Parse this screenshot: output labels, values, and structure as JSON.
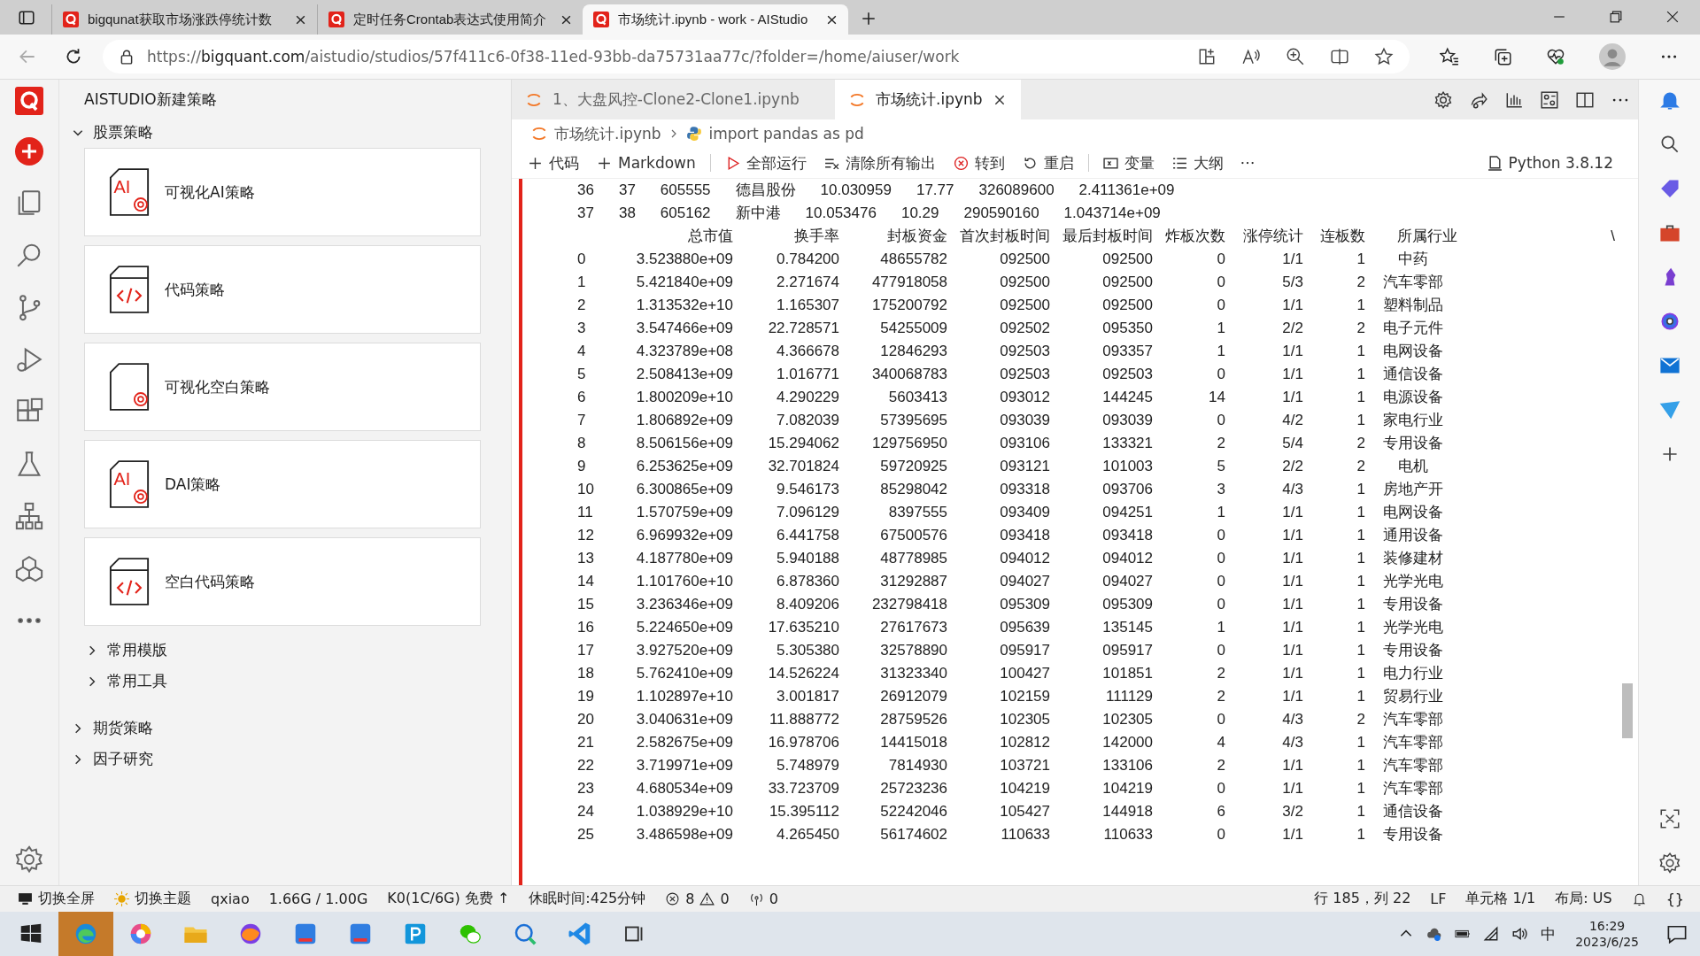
{
  "browser": {
    "tabs": [
      {
        "title": "bigqunat获取市场涨跌停统计数",
        "selected": false
      },
      {
        "title": "定时任务Crontab表达式使用简介",
        "selected": false
      },
      {
        "title": "市场统计.ipynb - work - AIStudio",
        "selected": true
      }
    ],
    "url": {
      "scheme": "https://",
      "host": "bigquant.com",
      "path": "/aistudio/studios/57f411c6-0f38-11ed-93bb-da75731aa77c/?folder=/home/aiuser/work"
    }
  },
  "sidebar": {
    "title": "AISTUDIO新建策略",
    "tree": [
      {
        "label": "股票策略",
        "expanded": true,
        "cards": [
          {
            "label": "可视化AI策略",
            "kind": "ai",
            "icon_text": "AI"
          },
          {
            "label": "代码策略",
            "kind": "code"
          },
          {
            "label": "可视化空白策略",
            "kind": "blank"
          },
          {
            "label": "DAI策略",
            "kind": "ai",
            "icon_text": "AI"
          },
          {
            "label": "空白代码策略",
            "kind": "code"
          }
        ],
        "children": [
          {
            "label": "常用模版",
            "expanded": false
          },
          {
            "label": "常用工具",
            "expanded": false
          }
        ]
      },
      {
        "label": "期货策略",
        "expanded": false
      },
      {
        "label": "因子研究",
        "expanded": false
      }
    ]
  },
  "editor": {
    "tabs": [
      {
        "title": "1、大盘风控-Clone2-Clone1.ipynb",
        "selected": false
      },
      {
        "title": "市场统计.ipynb",
        "selected": true
      }
    ],
    "breadcrumb": [
      "市场统计.ipynb",
      "import pandas as pd"
    ],
    "toolbar": [
      "代码",
      "Markdown",
      "全部运行",
      "清除所有输出",
      "转到",
      "重启",
      "变量",
      "大纲"
    ],
    "kernel": "Python 3.8.12",
    "output": {
      "top_rows": [
        [
          "36",
          "37",
          "605555",
          "德昌股份",
          "10.030959",
          "17.77",
          "326089600",
          "2.411361e+09"
        ],
        [
          "37",
          "38",
          "605162",
          "新中港",
          "10.053476",
          "10.29",
          "290590160",
          "1.043714e+09"
        ]
      ],
      "columns": [
        "",
        "总市值",
        "换手率",
        "封板资金",
        "首次封板时间",
        "最后封板时间",
        "炸板次数",
        "涨停统计",
        "连板数",
        "所属行业"
      ],
      "continuation": "\\",
      "rows": [
        [
          "0",
          "3.523880e+09",
          "0.784200",
          "48655782",
          "092500",
          "092500",
          "0",
          "1/1",
          "1",
          "中药"
        ],
        [
          "1",
          "5.421840e+09",
          "2.271674",
          "477918058",
          "092500",
          "092500",
          "0",
          "5/3",
          "2",
          "汽车零部"
        ],
        [
          "2",
          "1.313532e+10",
          "1.165307",
          "175200792",
          "092500",
          "092500",
          "0",
          "1/1",
          "1",
          "塑料制品"
        ],
        [
          "3",
          "3.547466e+09",
          "22.728571",
          "54255009",
          "092502",
          "095350",
          "1",
          "2/2",
          "2",
          "电子元件"
        ],
        [
          "4",
          "4.323789e+08",
          "4.366678",
          "12846293",
          "092503",
          "093357",
          "1",
          "1/1",
          "1",
          "电网设备"
        ],
        [
          "5",
          "2.508413e+09",
          "1.016771",
          "340068783",
          "092503",
          "092503",
          "0",
          "1/1",
          "1",
          "通信设备"
        ],
        [
          "6",
          "1.800209e+10",
          "4.290229",
          "5603413",
          "093012",
          "144245",
          "14",
          "1/1",
          "1",
          "电源设备"
        ],
        [
          "7",
          "1.806892e+09",
          "7.082039",
          "57395695",
          "093039",
          "093039",
          "0",
          "4/2",
          "1",
          "家电行业"
        ],
        [
          "8",
          "8.506156e+09",
          "15.294062",
          "129756950",
          "093106",
          "133321",
          "2",
          "5/4",
          "2",
          "专用设备"
        ],
        [
          "9",
          "6.253625e+09",
          "32.701824",
          "59720925",
          "093121",
          "101003",
          "5",
          "2/2",
          "2",
          "电机"
        ],
        [
          "10",
          "6.300865e+09",
          "9.546173",
          "85298042",
          "093318",
          "093706",
          "3",
          "4/3",
          "1",
          "房地产开"
        ],
        [
          "11",
          "1.570759e+09",
          "7.096129",
          "8397555",
          "093409",
          "094251",
          "1",
          "1/1",
          "1",
          "电网设备"
        ],
        [
          "12",
          "6.969932e+09",
          "6.441758",
          "67500576",
          "093418",
          "093418",
          "0",
          "1/1",
          "1",
          "通用设备"
        ],
        [
          "13",
          "4.187780e+09",
          "5.940188",
          "48778985",
          "094012",
          "094012",
          "0",
          "1/1",
          "1",
          "装修建材"
        ],
        [
          "14",
          "1.101760e+10",
          "6.878360",
          "31292887",
          "094027",
          "094027",
          "0",
          "1/1",
          "1",
          "光学光电"
        ],
        [
          "15",
          "3.236346e+09",
          "8.409206",
          "232798418",
          "095309",
          "095309",
          "0",
          "1/1",
          "1",
          "专用设备"
        ],
        [
          "16",
          "5.224650e+09",
          "17.635210",
          "27617673",
          "095639",
          "135145",
          "1",
          "1/1",
          "1",
          "光学光电"
        ],
        [
          "17",
          "3.927520e+09",
          "5.305380",
          "32578890",
          "095917",
          "095917",
          "0",
          "1/1",
          "1",
          "专用设备"
        ],
        [
          "18",
          "5.762410e+09",
          "14.526224",
          "31323340",
          "100427",
          "101851",
          "2",
          "1/1",
          "1",
          "电力行业"
        ],
        [
          "19",
          "1.102897e+10",
          "3.001817",
          "26912079",
          "102159",
          "111129",
          "2",
          "1/1",
          "1",
          "贸易行业"
        ],
        [
          "20",
          "3.040631e+09",
          "11.888772",
          "28759526",
          "102305",
          "102305",
          "0",
          "4/3",
          "2",
          "汽车零部"
        ],
        [
          "21",
          "2.582675e+09",
          "16.978706",
          "14415018",
          "102812",
          "142000",
          "4",
          "4/3",
          "1",
          "汽车零部"
        ],
        [
          "22",
          "3.719971e+09",
          "5.748979",
          "7814930",
          "103721",
          "133106",
          "2",
          "1/1",
          "1",
          "汽车零部"
        ],
        [
          "23",
          "4.680534e+09",
          "33.723709",
          "25723236",
          "104219",
          "104219",
          "0",
          "1/1",
          "1",
          "汽车零部"
        ],
        [
          "24",
          "1.038929e+10",
          "15.395112",
          "52242046",
          "105427",
          "144918",
          "6",
          "3/2",
          "1",
          "通信设备"
        ],
        [
          "25",
          "3.486598e+09",
          "4.265450",
          "56174602",
          "110633",
          "110633",
          "0",
          "1/1",
          "1",
          "专用设备"
        ]
      ]
    }
  },
  "status_bar": {
    "left": [
      "切换全屏",
      "切换主题",
      "qxiao",
      "1.66G / 1.00G",
      "K0(1C/6G) 免费 ↑",
      "休眠时间:425分钟"
    ],
    "errors": "8",
    "warnings": "0",
    "ports": "0",
    "right": [
      "行 185，列 22",
      "LF",
      "单元格 1/1",
      "布局: US"
    ],
    "braces": "{}"
  },
  "taskbar": {
    "apps": [
      {
        "selected": false
      },
      {
        "selected": true
      },
      {
        "selected": false
      },
      {
        "selected": false
      },
      {
        "selected": false
      },
      {
        "selected": false
      },
      {
        "selected": false
      },
      {
        "selected": false
      },
      {
        "selected": false
      },
      {
        "selected": false
      },
      {
        "selected": false
      },
      {
        "selected": false
      }
    ],
    "ime": "中",
    "time": "16:29",
    "date": "2023/6/25"
  }
}
